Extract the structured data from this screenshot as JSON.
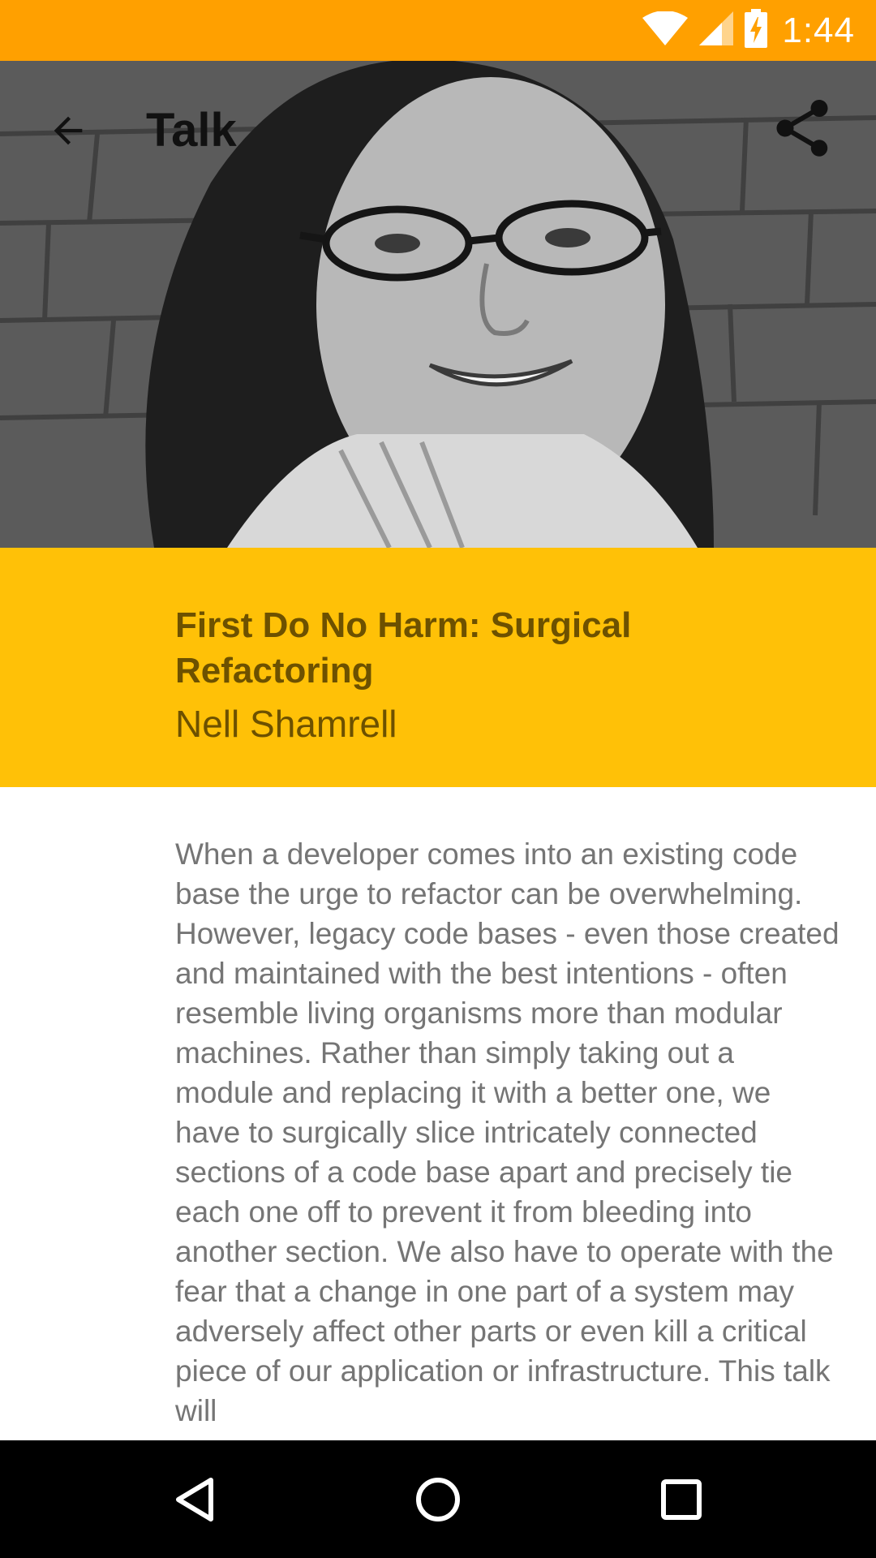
{
  "status_bar": {
    "time": "1:44",
    "background_color": "#FFA000",
    "icons": [
      "wifi-icon",
      "cell-signal-icon",
      "battery-charging-icon"
    ]
  },
  "toolbar": {
    "title": "Talk",
    "back_icon": "arrow-back-icon",
    "share_icon": "share-icon"
  },
  "hero": {
    "image_description_icon": "speaker-photo"
  },
  "talk": {
    "title": "First Do No Harm: Surgical Refactoring",
    "speaker": "Nell Shamrell",
    "panel_color": "#FFC107",
    "text_color": "#6D5100",
    "description": "When a developer comes into an existing code base the urge to refactor can be overwhelming. However, legacy code bases - even those created and maintained with the best intentions - often resemble living organisms more than modular machines. Rather than simply taking out a module and replacing it with a better one, we have to surgically slice intricately connected sections of a code base apart and precisely tie each one off to prevent it from bleeding into another section. We also have to operate with the fear that a change in one part of a system may adversely affect other parts or even kill a critical piece of our application or infrastructure. This talk will"
  },
  "nav_bar": {
    "buttons": [
      "nav-back-icon",
      "nav-home-icon",
      "nav-recents-icon"
    ]
  }
}
